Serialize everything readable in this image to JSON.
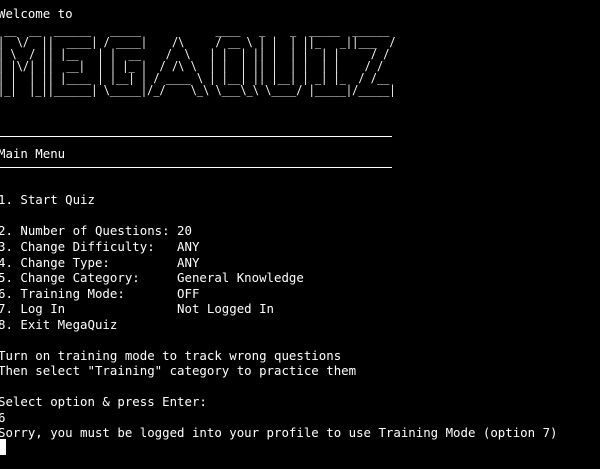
{
  "terminal": {
    "welcome": "Welcome to",
    "banner": [
      " __  __  ______   _____            ____   _    _  _____  ______",
      "|  \\/  ||  ____| / ____|    /\\     / __ \\ | |  | ||_   _||___  /",
      "| \\  / || |__   | |  __    /  \\   | |  | || |  | |  | |     / /",
      "| |\\/| ||  __|  | | |_ |  / /\\ \\  | |  | || |  | |  | |    / /",
      "| |  | || |____ | |__| | / ____ \\ | |__| || |__| | _| |_  / /__",
      "|_|  |_||______| \\_____|/_/    \\_\\ \\___\\_\\ \\____/ |_____|/_____|"
    ],
    "menu_title": "Main Menu",
    "menu_items": [
      "1. Start Quiz",
      "2. Number of Questions: 20",
      "3. Change Difficulty:   ANY",
      "4. Change Type:         ANY",
      "5. Change Category:     General Knowledge",
      "6. Training Mode:       OFF",
      "7. Log In               Not Logged In",
      "8. Exit MegaQuiz"
    ],
    "hint_1": "Turn on training mode to track wrong questions",
    "hint_2": "Then select \"Training\" category to practice them",
    "prompt": "Select option & press Enter:",
    "user_input": "6",
    "error_message": "Sorry, you must be logged into your profile to use Training Mode (option 7)"
  }
}
